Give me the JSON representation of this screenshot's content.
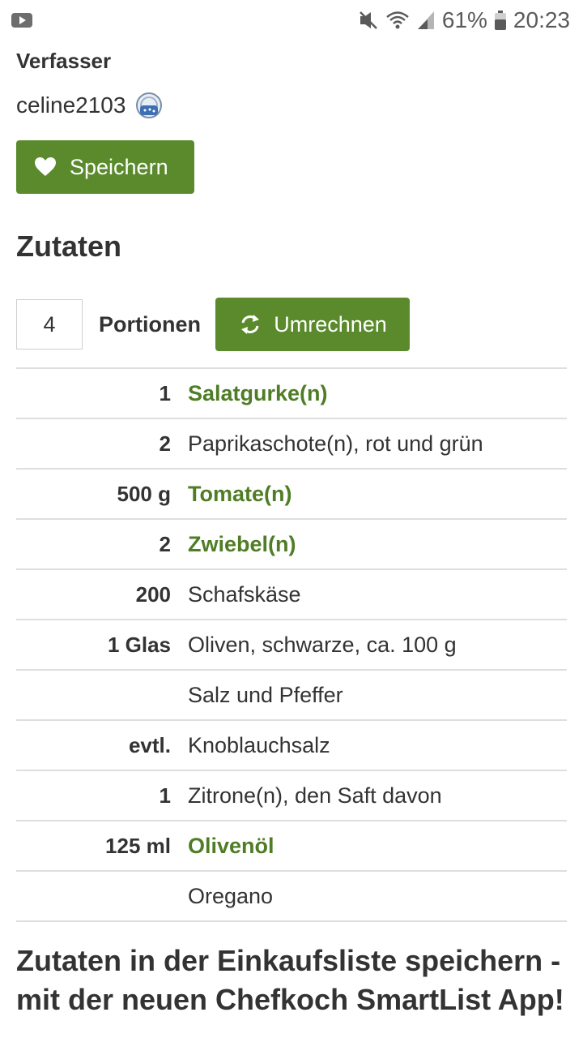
{
  "status_bar": {
    "battery": "61%",
    "time": "20:23",
    "icons": [
      "youtube-icon",
      "mute-icon",
      "wifi-icon",
      "signal-icon",
      "battery-icon"
    ]
  },
  "author": {
    "label": "Verfasser",
    "name": "celine2103"
  },
  "save_button": {
    "label": "Speichern"
  },
  "ingredients_section": {
    "title": "Zutaten",
    "portions_value": "4",
    "portions_label": "Portionen",
    "recalc_label": "Umrechnen",
    "items": [
      {
        "amount": "1",
        "name": "Salatgurke(n)",
        "link": true
      },
      {
        "amount": "2",
        "name": "Paprikaschote(n), rot und grün",
        "link": false
      },
      {
        "amount": "500 g",
        "name": "Tomate(n)",
        "link": true
      },
      {
        "amount": "2",
        "name": "Zwiebel(n)",
        "link": true
      },
      {
        "amount": "200",
        "name": "Schafskäse",
        "link": false
      },
      {
        "amount": "1 Glas",
        "name": "Oliven, schwarze, ca. 100 g",
        "link": false
      },
      {
        "amount": "",
        "name": "Salz und Pfeffer",
        "link": false
      },
      {
        "amount": "evtl.",
        "name": "Knoblauchsalz",
        "link": false
      },
      {
        "amount": "1",
        "name": "Zitrone(n), den Saft davon",
        "link": false
      },
      {
        "amount": "125 ml",
        "name": "Olivenöl",
        "link": true
      },
      {
        "amount": "",
        "name": "Oregano",
        "link": false
      }
    ]
  },
  "footer": {
    "title": "Zutaten in der Einkaufsliste speichern - mit der neuen Chefkoch SmartList App!"
  },
  "colors": {
    "accent_green": "#5a8a2c",
    "link_green": "#4f7d26",
    "text": "#333333"
  }
}
